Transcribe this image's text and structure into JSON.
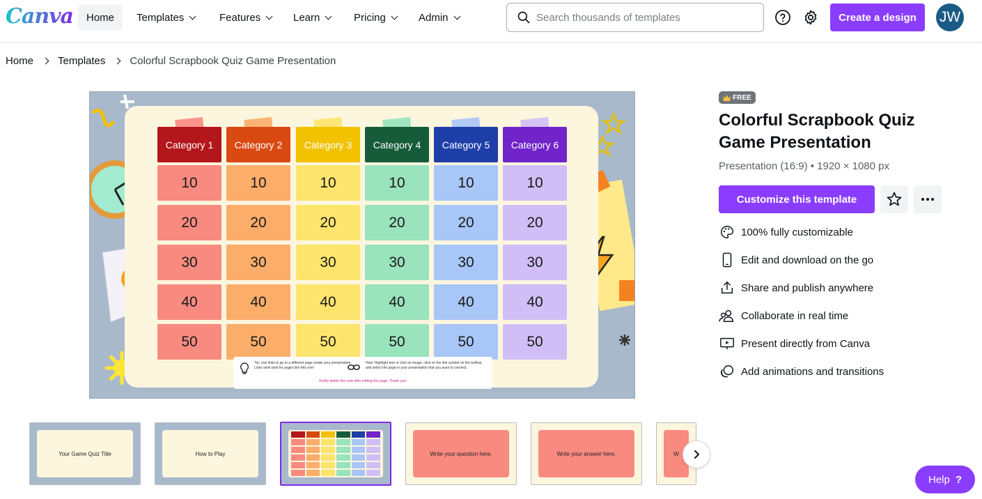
{
  "brand": {
    "logo": "Canva",
    "accent": "#8b3dff"
  },
  "nav": {
    "home": "Home",
    "templates": "Templates",
    "features": "Features",
    "learn": "Learn",
    "pricing": "Pricing",
    "admin": "Admin"
  },
  "search": {
    "placeholder": "Search thousands of templates"
  },
  "header": {
    "create_label": "Create a design",
    "avatar_initials": "JW"
  },
  "breadcrumb": {
    "home": "Home",
    "templates": "Templates",
    "current": "Colorful Scrapbook Quiz Game Presentation"
  },
  "preview": {
    "categories": [
      "Category 1",
      "Category 2",
      "Category 3",
      "Category 4",
      "Category 5",
      "Category 6"
    ],
    "category_colors": [
      "#b3161b",
      "#d94a13",
      "#f2c200",
      "#175c3a",
      "#1f3fa8",
      "#7024c9"
    ],
    "cell_colors": [
      "#f98a80",
      "#fbad69",
      "#fde46c",
      "#99e3bd",
      "#a8c6f7",
      "#d0bef7"
    ],
    "values": [
      "10",
      "20",
      "30",
      "40",
      "50"
    ],
    "tip_text": "Tip: Use links to go to a different page inside your presentation. Links work best for pages like this one!",
    "how_text": "How: Highlight text or click an image, click on the link symbol on the toolbar, and select the page in your presentation that you want to connect.",
    "footer_text": "Kindly delete this note after editing this page. Thank you!"
  },
  "template": {
    "badge": "FREE",
    "title": "Colorful Scrapbook Quiz Game Presentation",
    "meta": "Presentation (16:9) • 1920 × 1080 px",
    "customize_label": "Customize this template"
  },
  "features": [
    {
      "icon": "palette-icon",
      "label": "100% fully customizable"
    },
    {
      "icon": "phone-icon",
      "label": "Edit and download on the go"
    },
    {
      "icon": "share-icon",
      "label": "Share and publish anywhere"
    },
    {
      "icon": "people-icon",
      "label": "Collaborate in real time"
    },
    {
      "icon": "present-icon",
      "label": "Present directly from Canva"
    },
    {
      "icon": "animation-icon",
      "label": "Add animations and transitions"
    }
  ],
  "thumbnails": [
    {
      "text": "Your Game Quiz Title",
      "bg": "#fdf6de"
    },
    {
      "text": "How to Play",
      "bg": "#fdf6de"
    },
    {
      "text": "",
      "bg": "#fdf6de"
    },
    {
      "text": "Write your question here.",
      "bg": "#f98a80"
    },
    {
      "text": "Write your answer here.",
      "bg": "#f98a80"
    },
    {
      "text": "W",
      "bg": "#f98a80"
    }
  ],
  "help": {
    "label": "Help",
    "glyph": "?"
  }
}
